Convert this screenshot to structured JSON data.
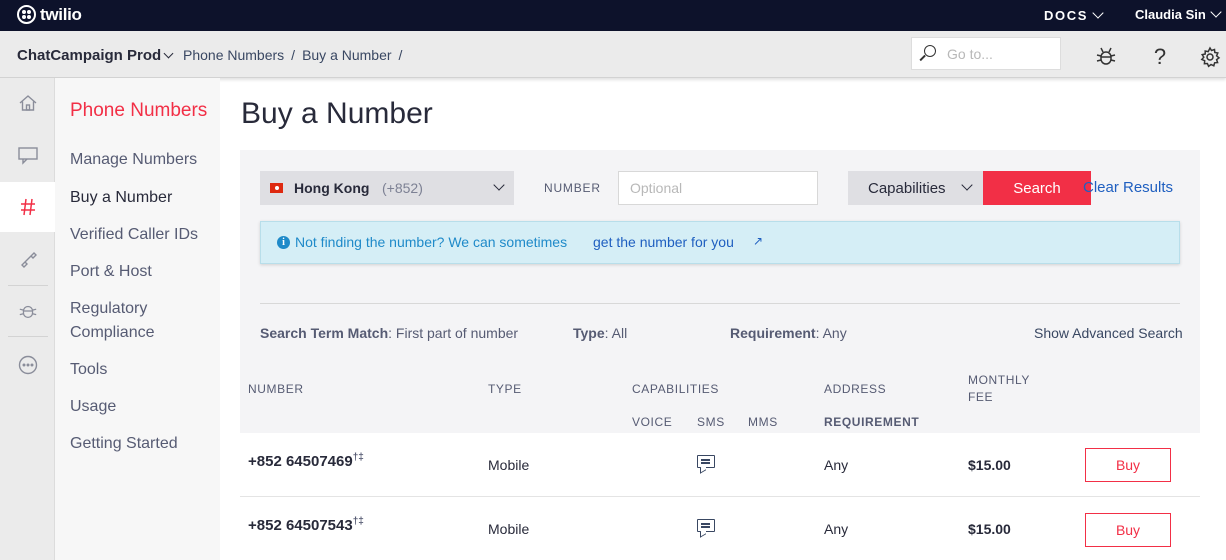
{
  "topbar": {
    "brand": "twilio",
    "docs_label": "DOCS",
    "user_name": "Claudia Sin"
  },
  "subbar": {
    "project": "ChatCampaign Prod",
    "breadcrumbs": [
      "Phone Numbers",
      "Buy a Number"
    ],
    "goto_placeholder": "Go to...",
    "icons": [
      "debugger-icon",
      "help-icon",
      "settings-icon"
    ]
  },
  "rail": {
    "icons": [
      "home-icon",
      "chat-icon",
      "hash-icon",
      "phone-icon",
      "bug-icon",
      "more-icon"
    ],
    "active": "hash-icon"
  },
  "nav": {
    "title": "Phone Numbers",
    "items": [
      {
        "label": "Manage Numbers"
      },
      {
        "label": "Buy a Number"
      },
      {
        "label": "Verified Caller IDs"
      },
      {
        "label": "Port & Host"
      },
      {
        "label": "Regulatory"
      },
      {
        "label": "Compliance"
      },
      {
        "label": "Tools"
      },
      {
        "label": "Usage"
      },
      {
        "label": "Getting Started"
      }
    ]
  },
  "main": {
    "title": "Buy a Number",
    "search": {
      "country": "Hong Kong",
      "country_code": "(+852)",
      "number_label": "NUMBER",
      "number_placeholder": "Optional",
      "capabilities_label": "Capabilities",
      "search_button": "Search",
      "clear_link": "Clear Results"
    },
    "notice": {
      "text": "Not finding the number? We can sometimes",
      "link": "get the number for you",
      "link_icon": "↗"
    },
    "criteria": {
      "term_label": "Search Term Match",
      "term_value": ": First part of number",
      "type_label": "Type",
      "type_value": ": All",
      "req_label": "Requirement",
      "req_value": ": Any",
      "advanced": "Show Advanced Search"
    },
    "table": {
      "headers": {
        "number": "NUMBER",
        "type": "TYPE",
        "capabilities": "CAPABILITIES",
        "voice": "VOICE",
        "sms": "SMS",
        "mms": "MMS",
        "address": "ADDRESS",
        "requirement": "REQUIREMENT",
        "fee_line1": "MONTHLY",
        "fee_line2": "FEE"
      },
      "rows": [
        {
          "number": "+852 64507469",
          "marks": "†‡",
          "type": "Mobile",
          "sms": true,
          "requirement": "Any",
          "fee": "$15.00",
          "action": "Buy"
        },
        {
          "number": "+852 64507543",
          "marks": "†‡",
          "type": "Mobile",
          "sms": true,
          "requirement": "Any",
          "fee": "$15.00",
          "action": "Buy"
        }
      ]
    }
  },
  "colors": {
    "topbar": "#0d122b",
    "accent": "#f22f46",
    "link": "#1f5fc0",
    "notice_bg": "#d5eef6"
  }
}
